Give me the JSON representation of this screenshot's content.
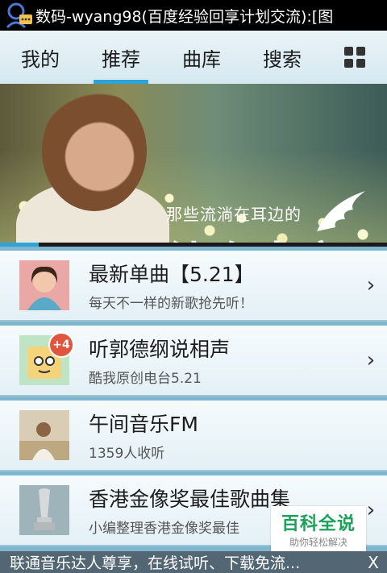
{
  "statusbar": {
    "title": "数码-wyang98(百度经验回享计划交流):[图",
    "icon": "chat-bubble-person-icon"
  },
  "tabs": [
    {
      "label": "我的",
      "active": false
    },
    {
      "label": "推荐",
      "active": true
    },
    {
      "label": "曲库",
      "active": false
    },
    {
      "label": "搜索",
      "active": false
    }
  ],
  "tab_menu_icon": "grid-icon",
  "banner": {
    "line1": "那些流淌在耳边的",
    "line2": "纯净声音"
  },
  "list": [
    {
      "title": "最新单曲【5.21】",
      "subtitle": "每天不一样的新歌抢先听！"
    },
    {
      "title": "听郭德纲说相声",
      "subtitle": "酷我原创电台5.21",
      "badge": "+4"
    },
    {
      "title": "午间音乐FM",
      "subtitle": "1359人收听"
    },
    {
      "title": "香港金像奖最佳歌曲集",
      "subtitle": "小编整理香港金像奖最佳"
    }
  ],
  "watermark": {
    "title": "百科全说",
    "subtitle": "助你轻松解决"
  },
  "ad": {
    "text": "联通音乐达人尊享，在线试听、下载免流...",
    "close": "X"
  },
  "colors": {
    "accent": "#2fa3d8",
    "badge": "#e2543e",
    "watermark_green": "#1aa25b"
  }
}
